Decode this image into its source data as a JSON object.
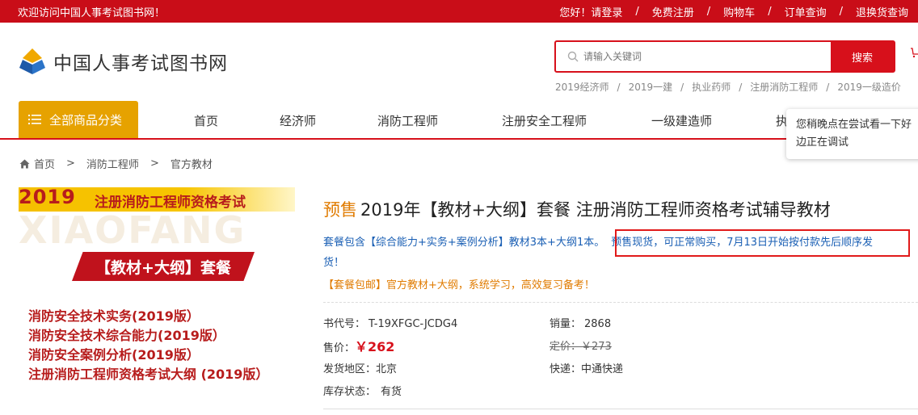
{
  "topbar": {
    "welcome": "欢迎访问中国人事考试图书网！",
    "links": [
      "您好！请登录",
      "免费注册",
      "购物车",
      "订单查询",
      "退换货查询"
    ],
    "separator": "/"
  },
  "header": {
    "logo_text": "中国人事考试图书网",
    "search_placeholder": "请输入关键词",
    "search_button": "搜索",
    "hotwords": [
      "2019经济师",
      "2019一建",
      "执业药师",
      "注册消防工程师",
      "2019一级造价"
    ],
    "hotword_separator": "/"
  },
  "nav": {
    "all_categories": "全部商品分类",
    "items": [
      "首页",
      "经济师",
      "消防工程师",
      "注册安全工程师",
      "一级建造师",
      "执"
    ]
  },
  "tooltip": {
    "line1": "您稍晚点在尝试看一下好",
    "line2": "边正在调试"
  },
  "breadcrumb": {
    "items": [
      "首页",
      "消防工程师",
      "官方教材"
    ],
    "arrow": ">"
  },
  "product_image": {
    "year": "2019",
    "title": "注册消防工程师资格考试",
    "watermark": "XIAOFANG",
    "bundle": "【教材+大纲】套餐",
    "books": [
      "消防安全技术实务(2019版）",
      "消防安全技术综合能力(2019版）",
      "消防安全案例分析(2019版）",
      "注册消防工程师资格考试大纲 (2019版）"
    ]
  },
  "product": {
    "presale_tag": "预售",
    "title": "2019年【教材+大纲】套餐 注册消防工程师资格考试辅导教材",
    "desc_part1": "套餐包含【综合能力+实务+案例分析】教材3本+大纲1本。",
    "desc_part2": "预售现货，可正常购买，7月13日开始按付款先后顺序发",
    "desc_part3": "货！",
    "promo": "【套餐包邮】官方教材+大纲，系统学习，高效复习备考！",
    "book_code_label": "书代号：",
    "book_code": "T-19XFGC-JCDG4",
    "sales_label": "销量：",
    "sales": "2868",
    "price_label": "售价：",
    "price": "￥262",
    "list_price_label": "定价：",
    "list_price": "￥273",
    "ship_from_label": "发货地区：",
    "ship_from": "北京",
    "courier_label": "快递：",
    "courier": "中通快递",
    "stock_label": "库存状态：",
    "stock": "有货"
  },
  "colors": {
    "brand_red": "#c90d18",
    "accent_orange": "#e6a200",
    "link_blue": "#1a5fb4"
  }
}
